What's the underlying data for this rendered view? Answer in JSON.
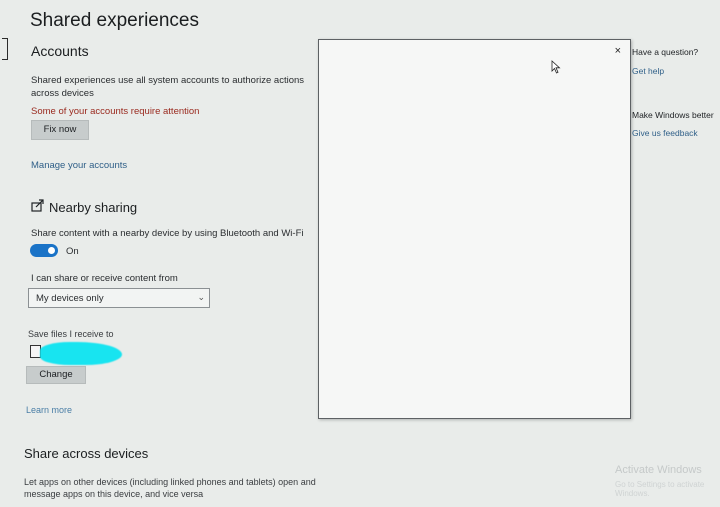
{
  "page": {
    "title": "Shared experiences"
  },
  "accounts": {
    "heading": "Accounts",
    "description": "Shared experiences use all system accounts to authorize actions across devices",
    "warning": "Some of your accounts require attention",
    "fix_button": "Fix now",
    "manage_link": "Manage your accounts"
  },
  "nearby": {
    "icon": "share-icon",
    "heading": "Nearby sharing",
    "description": "Share content with a nearby device by using Bluetooth and Wi-Fi",
    "toggle_label": "On",
    "toggle_on": true,
    "share_from_label": "I can share or receive content from",
    "share_from_value": "My devices only",
    "save_label": "Save files I receive to",
    "change_button": "Change",
    "learn_more": "Learn more"
  },
  "across": {
    "heading": "Share across devices",
    "description": "Let apps on other devices (including linked phones and tablets) open and message apps on this device, and vice versa"
  },
  "popup": {
    "close_glyph": "×"
  },
  "right_panel": {
    "question": "Have a question?",
    "get_help": "Get help",
    "make_better": "Make Windows better",
    "feedback": "Give us feedback"
  },
  "watermark": {
    "title": "Activate Windows",
    "subtitle": "Go to Settings to activate Windows."
  },
  "colors": {
    "accent": "#1a73c7",
    "link": "#2f5f88",
    "warning": "#9a2a1f",
    "background": "#e9ecea"
  }
}
